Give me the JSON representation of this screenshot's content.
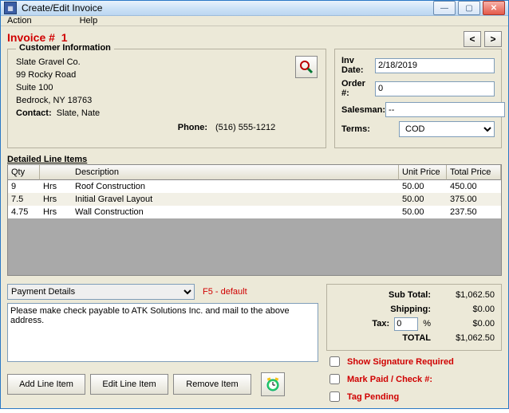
{
  "window": {
    "title": "Create/Edit Invoice"
  },
  "menu": {
    "action": "Action",
    "help": "Help"
  },
  "header": {
    "label": "Invoice  #",
    "number": "1",
    "prev": "<",
    "next": ">"
  },
  "customer": {
    "legend": "Customer Information",
    "name": "Slate Gravel Co.",
    "addr1": "99 Rocky Road",
    "addr2": "Suite 100",
    "citystate": "Bedrock, NY 18763",
    "contact_label": "Contact:",
    "contact_value": "Slate, Nate",
    "phone_label": "Phone:",
    "phone_value": "(516) 555-1212"
  },
  "fields": {
    "date_label": "Inv Date:",
    "date_value": "2/18/2019",
    "order_label": "Order #:",
    "order_value": "0",
    "salesman_label": "Salesman:",
    "salesman_value": "--",
    "terms_label": "Terms:",
    "terms_value": "COD"
  },
  "lines": {
    "section_label": "Detailed Line Items",
    "headers": {
      "qty": "Qty",
      "desc": "Description",
      "unit": "Unit Price",
      "total": "Total Price"
    },
    "rows": [
      {
        "qty": "9",
        "unit": "Hrs",
        "desc": "Roof Construction",
        "unit_price": "50.00",
        "total": "450.00"
      },
      {
        "qty": "7.5",
        "unit": "Hrs",
        "desc": "Initial Gravel Layout",
        "unit_price": "50.00",
        "total": "375.00"
      },
      {
        "qty": "4.75",
        "unit": "Hrs",
        "desc": "Wall Construction",
        "unit_price": "50.00",
        "total": "237.50"
      }
    ]
  },
  "payment": {
    "selected": "Payment Details",
    "hint": "F5 - default",
    "text": "Please make check payable to ATK Solutions Inc. and mail to the above address."
  },
  "totals": {
    "sub_label": "Sub Total:",
    "sub": "$1,062.50",
    "ship_label": "Shipping:",
    "ship": "$0.00",
    "tax_label": "Tax:",
    "tax_pct": "0",
    "pct": "%",
    "tax_val": "$0.00",
    "total_label": "TOTAL",
    "total": "$1,062.50"
  },
  "checks": {
    "sig": "Show Signature Required",
    "paid": "Mark Paid / Check #:",
    "tag": "Tag Pending"
  },
  "buttons": {
    "add": "Add Line Item",
    "edit": "Edit Line Item",
    "remove": "Remove Item"
  }
}
